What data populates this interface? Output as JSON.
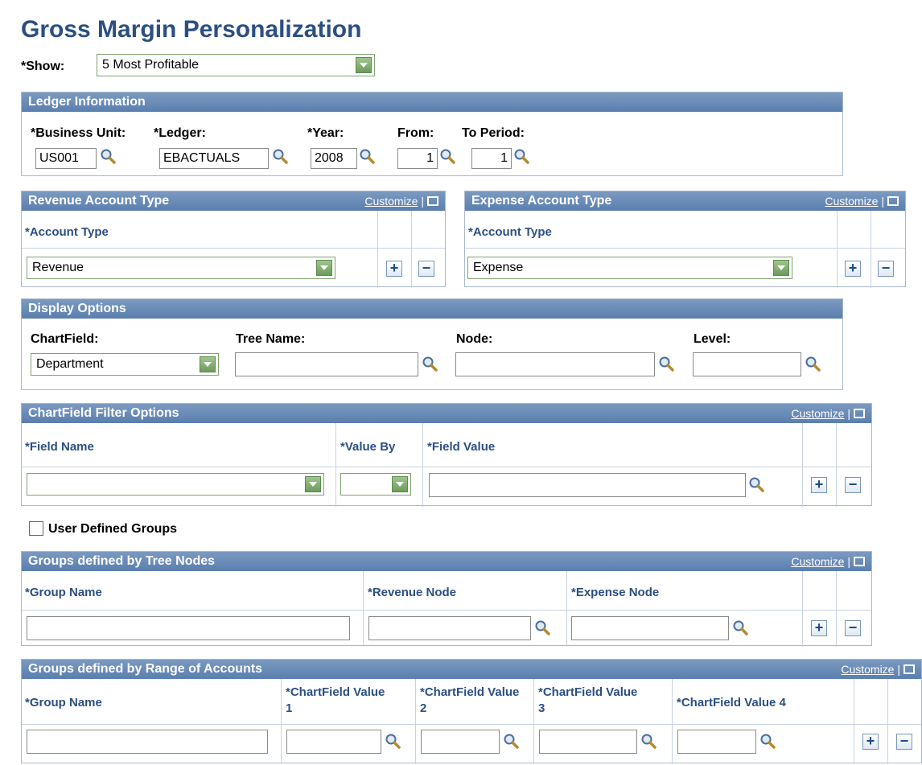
{
  "page_title": "Gross Margin Personalization",
  "show": {
    "label": "*Show:",
    "value": "5 Most Profitable"
  },
  "ledger": {
    "header": "Ledger Information",
    "business_unit_label": "*Business Unit:",
    "business_unit_value": "US001",
    "ledger_label": "*Ledger:",
    "ledger_value": "EBACTUALS",
    "year_label": "*Year:",
    "year_value": "2008",
    "from_label": "From:",
    "from_value": "1",
    "to_period_label": "To Period:",
    "to_period_value": "1"
  },
  "customize": "Customize",
  "customize_sep": "|",
  "revenue": {
    "header": "Revenue Account Type",
    "col_account_type": "*Account Type",
    "value": "Revenue"
  },
  "expense": {
    "header": "Expense Account Type",
    "col_account_type": "*Account Type",
    "value": "Expense"
  },
  "display": {
    "header": "Display Options",
    "chartfield_label": "ChartField:",
    "chartfield_value": "Department",
    "tree_name_label": "Tree Name:",
    "node_label": "Node:",
    "level_label": "Level:"
  },
  "filter": {
    "header": "ChartField Filter Options",
    "col_field_name": "*Field Name",
    "col_value_by": "*Value By",
    "col_field_value": "*Field Value"
  },
  "user_defined_groups": {
    "label": "User Defined Groups",
    "checked": false
  },
  "tree_groups": {
    "header": "Groups defined by Tree Nodes",
    "col_group_name": "*Group Name",
    "col_revenue_node": "*Revenue Node",
    "col_expense_node": "*Expense Node"
  },
  "range_groups": {
    "header": "Groups defined by Range of Accounts",
    "col_group_name": "*Group Name",
    "col_cf1": "*ChartField Value 1",
    "col_cf2": "*ChartField Value 2",
    "col_cf3": "*ChartField Value 3",
    "col_cf4": "*ChartField Value 4"
  },
  "icons": {
    "lookup": "magnifier-icon",
    "add": "plus-icon",
    "delete": "minus-icon",
    "popout": "popout-icon",
    "dropdown": "chevron-down-icon"
  },
  "colors": {
    "header_bg": "#5a7eae",
    "title": "#2b4f81",
    "dropdown_btn": "#7fae6c",
    "border": "#a9b9cc"
  }
}
